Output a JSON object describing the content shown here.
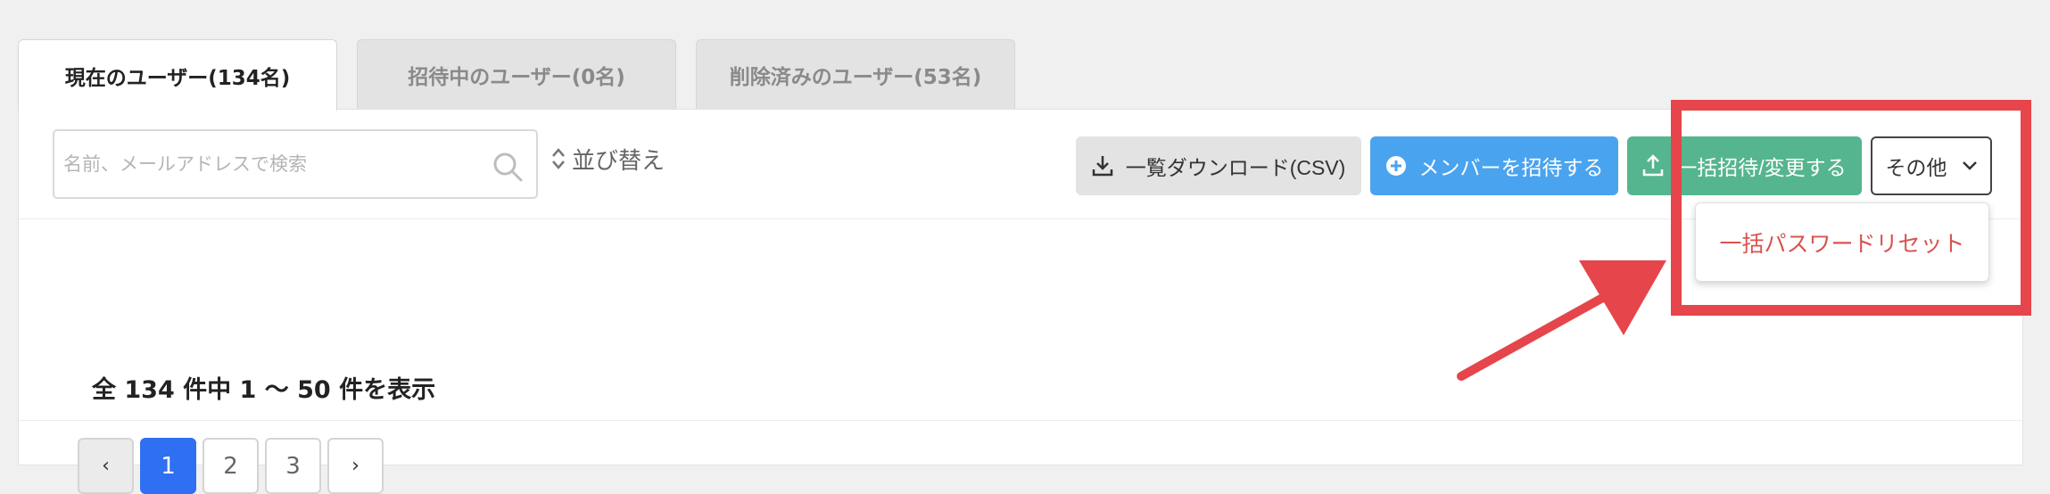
{
  "tabs": [
    {
      "label": "現在のユーザー(134名)",
      "active": true
    },
    {
      "label": "招待中のユーザー(0名)",
      "active": false
    },
    {
      "label": "削除済みのユーザー(53名)",
      "active": false
    }
  ],
  "search": {
    "placeholder": "名前、メールアドレスで検索",
    "value": ""
  },
  "sort": {
    "label": "並び替え"
  },
  "toolbar": {
    "csv_label": "一覧ダウンロード(CSV)",
    "invite_label": "メンバーを招待する",
    "bulk_label": "一括招待/変更する",
    "other_label": "その他"
  },
  "dropdown": {
    "items": [
      "一括パスワードリセット"
    ]
  },
  "summary": "全 134 件中 1 〜 50 件を表示",
  "pagination": {
    "prev": "‹",
    "pages": [
      "1",
      "2",
      "3"
    ],
    "current": "1",
    "next": "›"
  },
  "colors": {
    "primary": "#2f6ff2",
    "invite": "#4aa3ef",
    "bulk": "#55b58f",
    "danger": "#d9534f",
    "highlight": "#e5454b"
  }
}
